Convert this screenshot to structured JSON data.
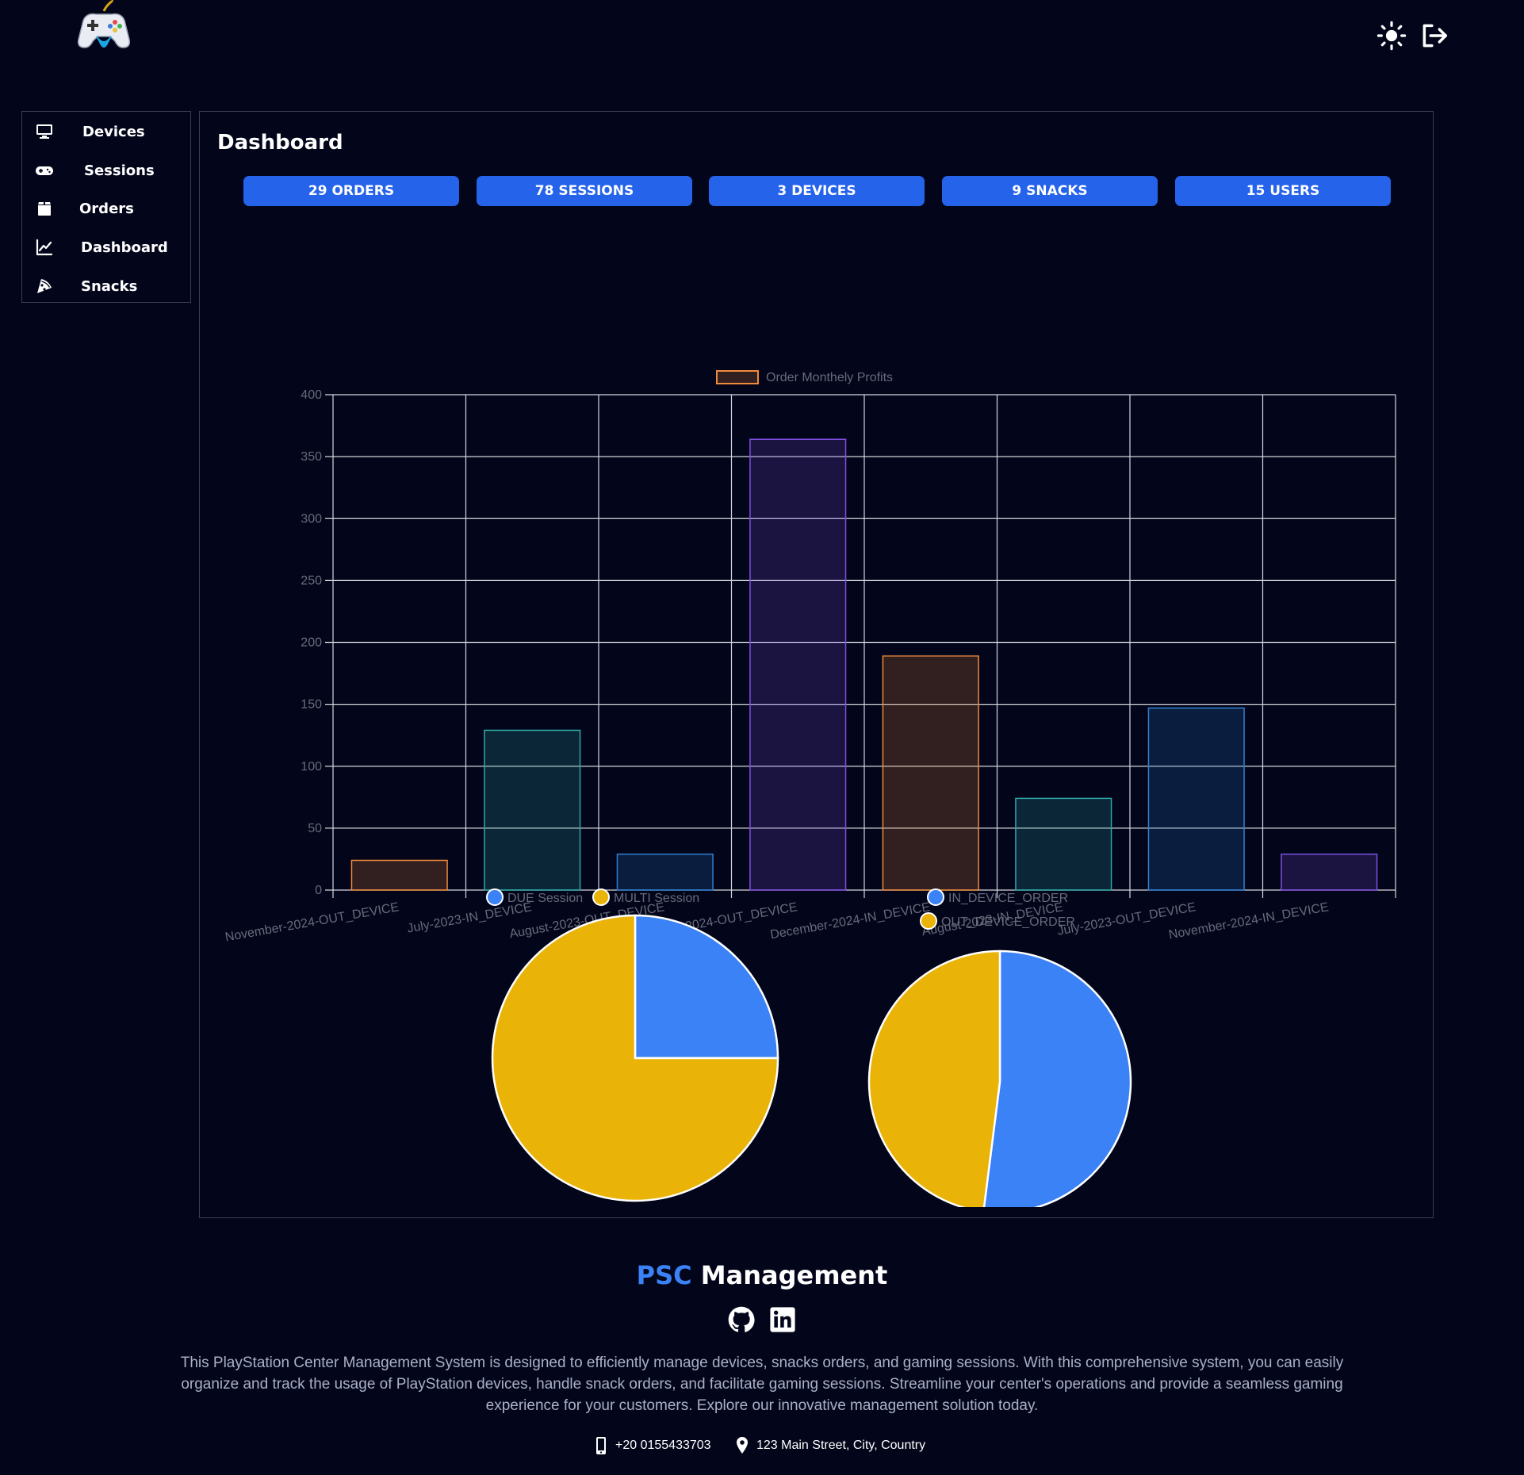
{
  "header": {
    "logo_icon": "gamepad-logo-icon",
    "theme_icon": "sun-icon",
    "logout_icon": "logout-icon"
  },
  "sidebar": {
    "items": [
      {
        "label": "Devices",
        "icon": "monitor-icon"
      },
      {
        "label": "Sessions",
        "icon": "gamepad-icon"
      },
      {
        "label": "Orders",
        "icon": "orders-icon"
      },
      {
        "label": "Dashboard",
        "icon": "chart-line-icon"
      },
      {
        "label": "Snacks",
        "icon": "pizza-icon"
      }
    ]
  },
  "main": {
    "title": "Dashboard",
    "stats": [
      {
        "label": "29 ORDERS"
      },
      {
        "label": "78 SESSIONS"
      },
      {
        "label": "3 DEVICES"
      },
      {
        "label": "9 SNACKS"
      },
      {
        "label": "15 USERS"
      }
    ]
  },
  "colors": {
    "accent": "#2563eb",
    "blue": "#3b82f6",
    "yellow": "#eab308",
    "background": "#03061a"
  },
  "chart_data": [
    {
      "type": "bar",
      "categories": [
        "November-2024-OUT_DEVICE",
        "July-2023-IN_DEVICE",
        "August-2023-OUT_DEVICE",
        "December-2024-OUT_DEVICE",
        "December-2024-IN_DEVICE",
        "August-2023-IN_DEVICE",
        "July-2023-OUT_DEVICE",
        "November-2024-IN_DEVICE"
      ],
      "series": [
        {
          "name": "Order Monthely Profits",
          "values": [
            24,
            129,
            29,
            364,
            189,
            74,
            147,
            29
          ]
        }
      ],
      "bar_colors": [
        "#f08a3c",
        "#2fa8a8",
        "#2f7fd0",
        "#7c4fe0",
        "#f08a3c",
        "#2fa8a8",
        "#2f7fd0",
        "#7c4fe0"
      ],
      "legend_color": "#f08a3c",
      "ylim": [
        0,
        400
      ],
      "yticks": [
        0,
        50,
        100,
        150,
        200,
        250,
        300,
        350,
        400
      ],
      "grid": true,
      "legend": "top"
    },
    {
      "type": "pie",
      "labels": [
        "DUE Session",
        "MULTI Session"
      ],
      "values": [
        25,
        75
      ],
      "colors": [
        "#3b82f6",
        "#eab308"
      ],
      "legend": "top"
    },
    {
      "type": "pie",
      "labels": [
        "IN_DEVICE_ORDER",
        "OUT_DEVICE_ORDER"
      ],
      "values": [
        52,
        48
      ],
      "colors": [
        "#3b82f6",
        "#eab308"
      ],
      "legend": "top"
    }
  ],
  "footer": {
    "brand_accent": "PSC",
    "brand_rest": " Management",
    "github_icon": "github-icon",
    "linkedin_icon": "linkedin-icon",
    "description": "This PlayStation Center Management System is designed to efficiently manage devices, snacks orders, and gaming sessions. With this comprehensive system, you can easily organize and track the usage of PlayStation devices, handle snack orders, and facilitate gaming sessions. Streamline your center's operations and provide a seamless gaming experience for your customers. Explore our innovative management solution today.",
    "phone": "+20 0155433703",
    "address": "123 Main Street, City, Country",
    "phone_icon": "phone-icon",
    "location_icon": "location-pin-icon"
  }
}
